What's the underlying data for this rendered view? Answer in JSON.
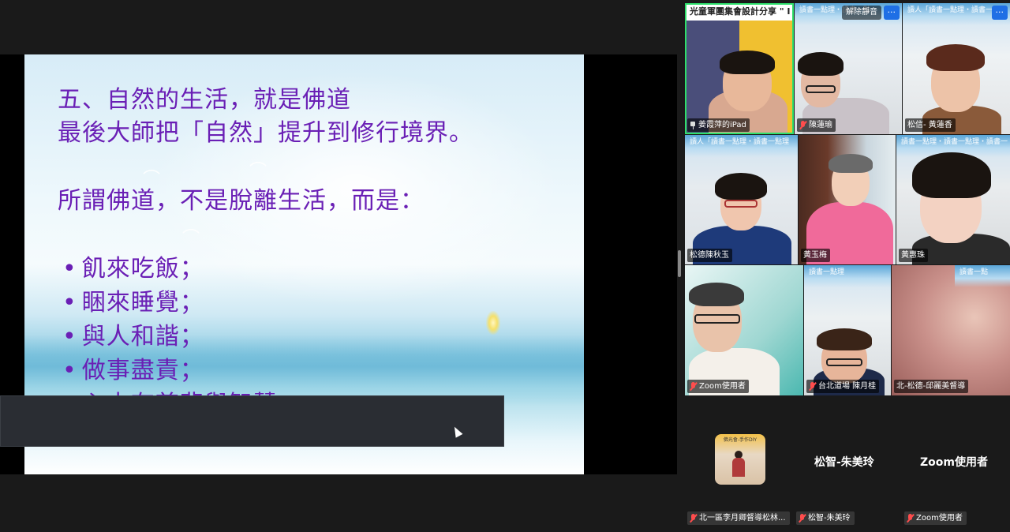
{
  "slide": {
    "line1": "五、自然的生活，就是佛道",
    "line2": "最後大師把「自然」提升到修行境界。",
    "line3": "所謂佛道，不是脫離生活，而是：",
    "bullets": [
      "飢來吃飯；",
      "睏來睡覺；",
      "與人和諧；",
      "做事盡責；"
    ],
    "cut_line": "心中有慈悲與智慧"
  },
  "gallery": {
    "tiles": [
      {
        "name": "姜霞萍的iPad",
        "banner": "光童軍團集會設計分享 \" I",
        "active": true
      },
      {
        "name": "陳蓮瑜",
        "banner": "讀書一點理・讀書一點",
        "unmute": "解除靜音",
        "menu": "···"
      },
      {
        "name": "松信- 黃蓮香",
        "banner": "讀人「讀書一點理・讀書一點",
        "menu": "···"
      },
      {
        "name": "松德陳秋玉",
        "banner": "讀人「讀書一點理・讀書一點理"
      },
      {
        "name": "黃玉梅",
        "banner": ""
      },
      {
        "name": "黃惠珠",
        "banner": "讀書一點理・讀書一點理・讀書一"
      },
      {
        "name": "Zoom使用者",
        "banner": ""
      },
      {
        "name": "台北道場 陳月桂",
        "banner": "讀書一點理"
      },
      {
        "name": "北-松德-邱麗美督導",
        "banner": "讀書一點"
      }
    ]
  },
  "strip": {
    "tiles": [
      {
        "label": "北一區李月卿督導松林...",
        "thumb_text": "佛光會-手作DIY"
      },
      {
        "label": "松智-朱美玲",
        "center_name": "松智-朱美玲"
      },
      {
        "label": "Zoom使用者",
        "center_name": "Zoom使用者"
      }
    ]
  },
  "colors": {
    "slide_text": "#6a1fb5",
    "active_speaker": "#2ee06b",
    "mute_icon": "#ff4d4d",
    "menu_button": "#1f6fe5"
  }
}
